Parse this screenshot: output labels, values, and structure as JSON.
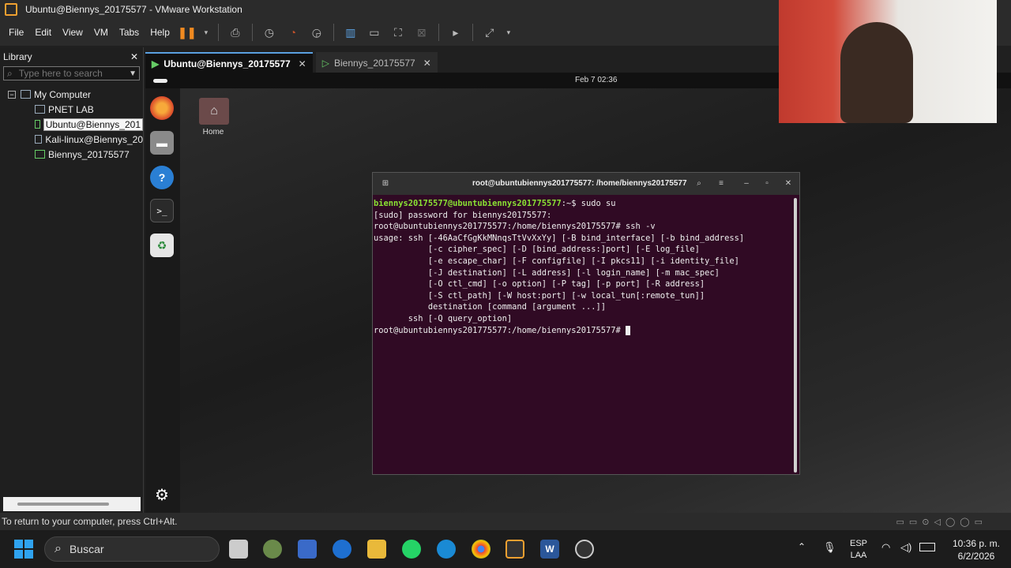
{
  "window": {
    "title": "Ubuntu@Biennys_20175577 - VMware Workstation"
  },
  "menu": [
    "File",
    "Edit",
    "View",
    "VM",
    "Tabs",
    "Help"
  ],
  "library": {
    "title": "Library",
    "search_placeholder": "Type here to search",
    "root": "My Computer",
    "items": [
      "PNET LAB",
      "Ubuntu@Biennys_201",
      "Kali-linux@Biennys_20",
      "Biennys_20175577"
    ]
  },
  "tabs": [
    {
      "label": "Ubuntu@Biennys_20175577"
    },
    {
      "label": "Biennys_20175577"
    }
  ],
  "guest": {
    "date": "Feb 7  02:36",
    "home_label": "Home",
    "terminal": {
      "title": "root@ubuntubiennys201775577: /home/biennys20175577",
      "lines": [
        "[sudo] password for biennys20175577:",
        "root@ubuntubiennys201775577:/home/biennys20175577# ssh -v",
        "usage: ssh [-46AaCfGgKkMNnqsTtVvXxYy] [-B bind_interface] [-b bind_address]",
        "           [-c cipher_spec] [-D [bind_address:]port] [-E log_file]",
        "           [-e escape_char] [-F configfile] [-I pkcs11] [-i identity_file]",
        "           [-J destination] [-L address] [-l login_name] [-m mac_spec]",
        "           [-O ctl_cmd] [-o option] [-P tag] [-p port] [-R address]",
        "           [-S ctl_path] [-W host:port] [-w local_tun[:remote_tun]]",
        "           destination [command [argument ...]]",
        "       ssh [-Q query_option]"
      ],
      "first_prompt_user": "biennys20175577@ubuntubiennys201775577",
      "first_prompt_rest": ":~$ sudo su",
      "last_prompt": "root@ubuntubiennys201775577:/home/biennys20175577# "
    }
  },
  "statusbar": {
    "text": "To return to your computer, press Ctrl+Alt."
  },
  "taskbar": {
    "search": "Buscar",
    "lang": "ESP",
    "lang2": "LAA",
    "time": "10:36 p. m.",
    "date": "6/2/2026"
  },
  "colors": {
    "terminal_bg": "#300a24",
    "prompt_green": "#8ae234",
    "accent": "#2fa3f0"
  }
}
